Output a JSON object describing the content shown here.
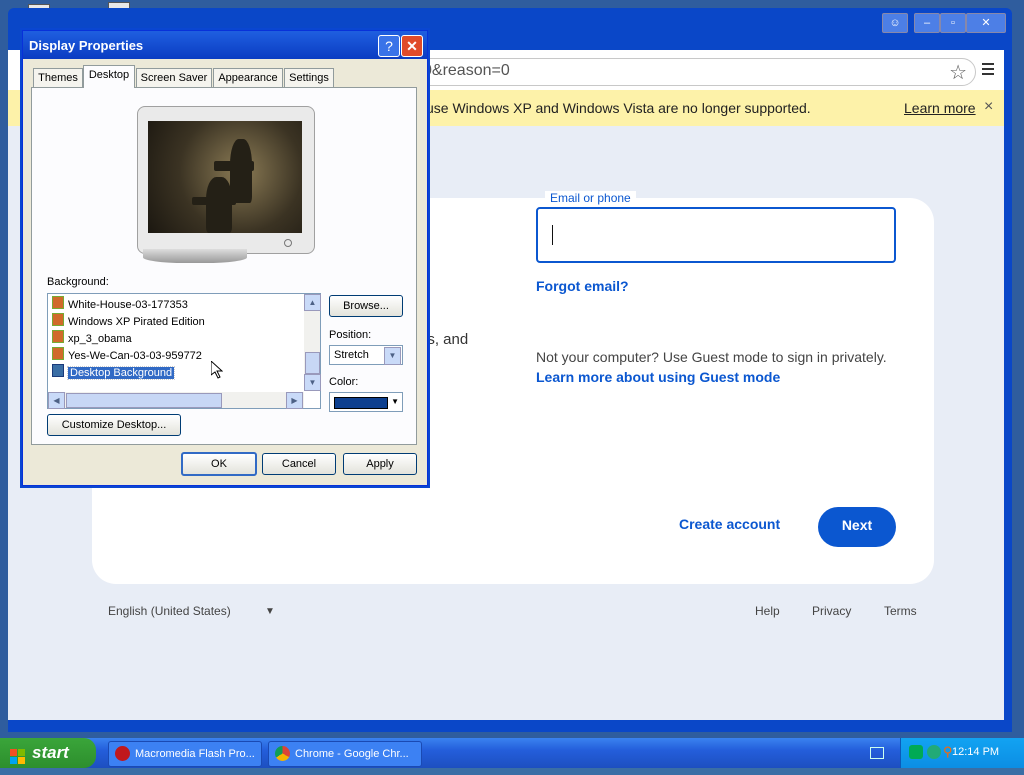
{
  "chrome": {
    "address": "0&reason=0",
    "banner_text": "use Windows XP and Windows Vista are no longer supported.",
    "banner_link": "Learn more",
    "banner_close": "×",
    "email_label": "Email or phone",
    "forgot_email": "Forgot email?",
    "fragment_text": "ds, and",
    "not_your_computer": "Not your computer? Use Guest mode to sign in privately.",
    "guest_link": "Learn more about using Guest mode",
    "create_account": "Create account",
    "next": "Next",
    "language": "English (United States)",
    "footer_links": [
      "Help",
      "Privacy",
      "Terms"
    ],
    "icons": [
      "user-icon",
      "minimize-icon",
      "restore-icon",
      "close-icon",
      "star-icon",
      "menu-icon"
    ]
  },
  "dialog": {
    "title": "Display Properties",
    "help": "?",
    "close": "✕",
    "tabs": [
      "Themes",
      "Desktop",
      "Screen Saver",
      "Appearance",
      "Settings"
    ],
    "active_tab": "Desktop",
    "background_label": "Background:",
    "backgrounds": [
      "White-House-03-177353",
      "Windows XP Pirated Edition",
      "xp_3_obama",
      "Yes-We-Can-03-03-959772",
      "Desktop Background"
    ],
    "selected_background": "Desktop Background",
    "browse": "Browse...",
    "position_label": "Position:",
    "position_value": "Stretch",
    "color_label": "Color:",
    "color_value": "#0d3f8f",
    "customize": "Customize Desktop...",
    "ok": "OK",
    "cancel": "Cancel",
    "apply": "Apply"
  },
  "taskbar": {
    "start": "start",
    "tasks": [
      "Macromedia Flash Pro...",
      "Chrome - Google Chr..."
    ],
    "clock": "12:14 PM"
  },
  "colors": {
    "xp_blue": "#245edb",
    "google_blue": "#0b57d0",
    "banner_yellow": "#fdf2a9",
    "dialog_bg": "#ece9d8"
  }
}
